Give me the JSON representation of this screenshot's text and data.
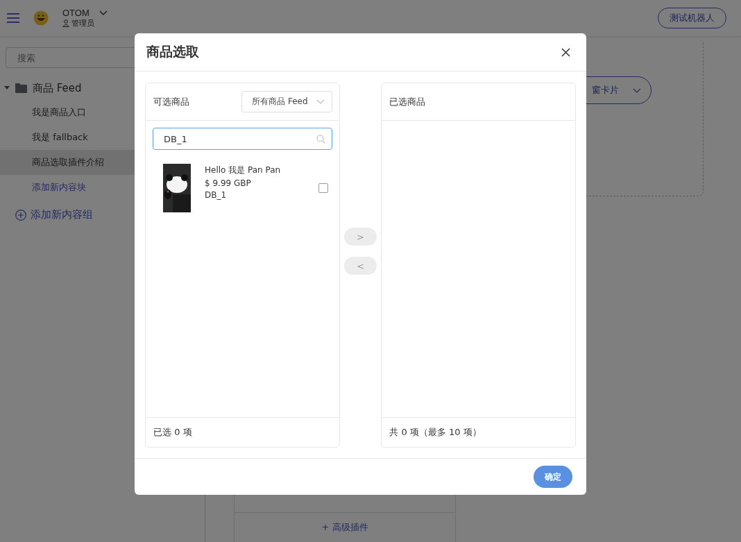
{
  "header": {
    "user_name": "OTOM",
    "user_role": "管理员",
    "robot_button": "测试机器人"
  },
  "sidebar": {
    "search": {
      "placeholder": "搜索"
    },
    "tree": [
      {
        "label": "商品 Feed",
        "expanded": true,
        "children": [
          {
            "kind": "item",
            "label": "我是商品入口",
            "selected": false
          },
          {
            "kind": "item",
            "label": "我是 fallback",
            "selected": false
          },
          {
            "kind": "item",
            "label": "商品选取插件介绍",
            "selected": true
          },
          {
            "kind": "link",
            "label": "添加新内容块",
            "selected": false
          }
        ]
      }
    ],
    "add_group": "添加新内容组"
  },
  "main": {
    "card_dropdown": "窗卡片",
    "add_rows": [
      "+ 高级插件"
    ]
  },
  "dialog": {
    "title": "商品选取",
    "source": {
      "title": "可选商品",
      "filter": "所有商品 Feed",
      "search_value": "DB_1",
      "items": [
        {
          "kind": "picture",
          "name": "Hello 我是 Pan Pan",
          "price": "$ 9.99 GBP",
          "sku": "DB_1",
          "checked": false
        }
      ],
      "footer": "已选 0 项"
    },
    "transfer": [
      {
        "label": ">",
        "disabled": true
      },
      {
        "label": "<",
        "disabled": true
      }
    ],
    "target": {
      "title": "已选商品",
      "footer": "共 0 项（最多 10 项）"
    },
    "confirm": "确定"
  }
}
